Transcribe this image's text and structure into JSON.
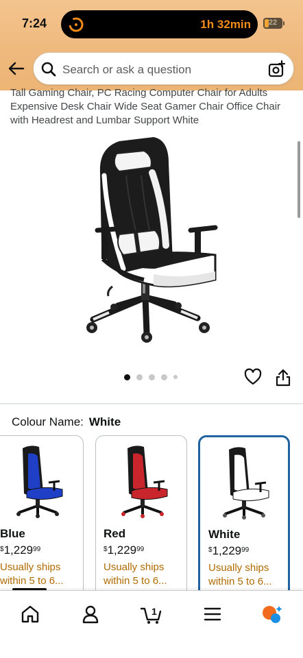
{
  "status_bar": {
    "time": "7:24",
    "activity_timer": "1h 32min",
    "battery_level": "22"
  },
  "header": {
    "search_placeholder": "Search or ask a question"
  },
  "product": {
    "title_lines": [
      "Tall Gaming Chair, PC Racing Computer Chair for Adults",
      "Expensive Desk Chair Wide Seat Gamer Chair Office Chair",
      "with Headrest and Lumbar Support White"
    ],
    "image_count": 5,
    "active_image_index": 0
  },
  "variation": {
    "label": "Colour Name:",
    "selected": "White",
    "options": [
      {
        "name": "Blue",
        "currency": "$",
        "price_whole": "1,229",
        "price_fraction": "99",
        "shipping_line1": "Usually ships",
        "shipping_line2": "within 5 to 6...",
        "seat_color": "#1f3fc7",
        "selected": false
      },
      {
        "name": "Red",
        "currency": "$",
        "price_whole": "1,229",
        "price_fraction": "99",
        "shipping_line1": "Usually ships",
        "shipping_line2": "within 5 to 6...",
        "seat_color": "#c9252c",
        "selected": false
      },
      {
        "name": "White",
        "currency": "$",
        "price_whole": "1,229",
        "price_fraction": "99",
        "shipping_line1": "Usually ships",
        "shipping_line2": "within 5 to 6...",
        "seat_color": "#ffffff",
        "selected": true
      }
    ]
  },
  "bottom_nav": {
    "items": [
      "home-icon",
      "account-icon",
      "cart-icon",
      "menu-icon",
      "rufus-icon"
    ],
    "cart_count": "1"
  },
  "colors": {
    "header_accent": "#f3c48f",
    "selected_border": "#2162a1",
    "shipping_text": "#b06b00",
    "island_text": "#f28c18"
  }
}
